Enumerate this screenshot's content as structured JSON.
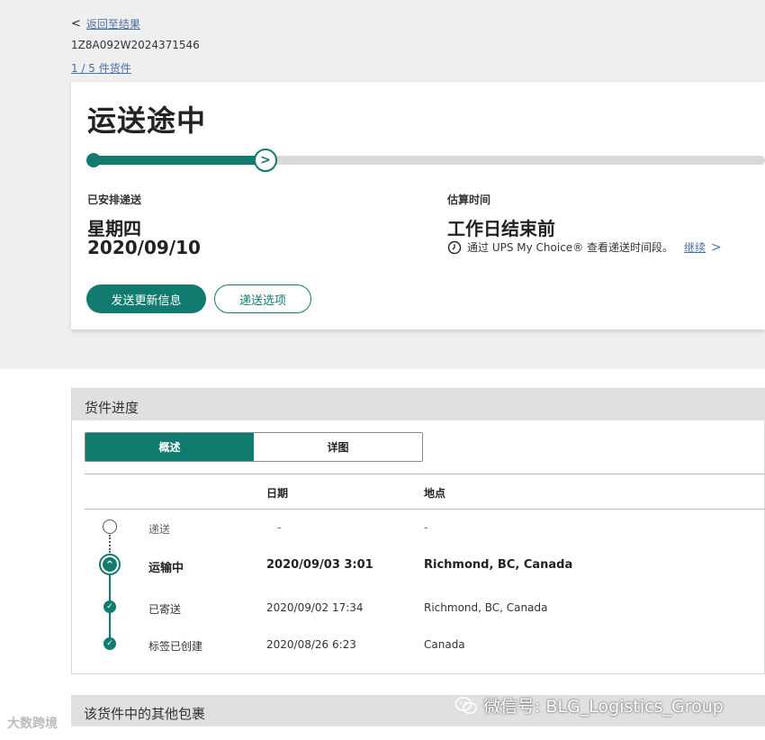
{
  "nav": {
    "back_arrow": "<",
    "back_label": "返回至结果",
    "tracking_number": "1Z8A092W2024371546",
    "package_count": "1 / 5 件货件"
  },
  "status": {
    "title": "运送途中",
    "progress_fraction": 0.28,
    "scheduled_label": "已安排递送",
    "scheduled_day": "星期四",
    "scheduled_date": "2020/09/10",
    "estimate_label": "估算时间",
    "estimate_value": "工作日结束前",
    "estimate_note": "通过 UPS My Choice® 查看递送时间段。",
    "continue_link": "继续",
    "continue_chevron": ">",
    "knob_chevron": ">",
    "btn_send_updates": "发送更新信息",
    "btn_delivery_options": "递送选项"
  },
  "progress_section": {
    "title": "货件进度",
    "tab_overview": "概述",
    "tab_detail": "详图",
    "col_date": "日期",
    "col_location": "地点",
    "rows": [
      {
        "status": "递送",
        "date": "-",
        "location": "-",
        "state": "pending"
      },
      {
        "status": "运输中",
        "date": "2020/09/03  3:01",
        "location": "Richmond, BC, Canada",
        "state": "current"
      },
      {
        "status": "已寄送",
        "date": "2020/09/02  17:34",
        "location": "Richmond, BC, Canada",
        "state": "done"
      },
      {
        "status": "标签已创建",
        "date": "2020/08/26  6:23",
        "location": "Canada",
        "state": "done"
      }
    ],
    "current_icon_glyph": "^",
    "done_icon_glyph": "✓"
  },
  "other_packages": {
    "title": "该货件中的其他包裹"
  },
  "watermarks": {
    "left": "大数跨境",
    "right": "微信号: BLG_Logistics_Group"
  },
  "colors": {
    "brand": "#127b6f",
    "link": "#4a6fa5"
  },
  "icons": {
    "clock": "clock-icon",
    "wechat": "wechat-icon"
  }
}
